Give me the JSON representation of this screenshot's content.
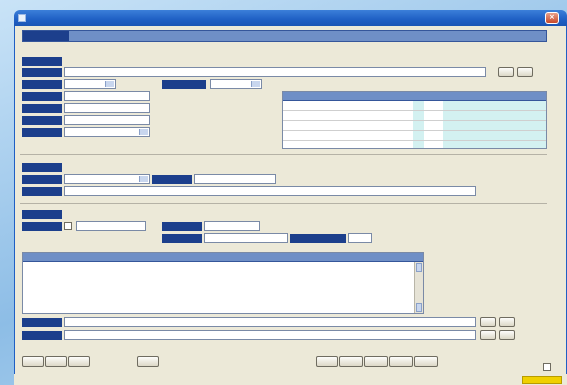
{
  "window": {
    "title": "",
    "colors": {
      "titlebar": "#1f5fc4",
      "band": "#6f8fc6",
      "grid_highlight": "#d3f1f1",
      "status_badge": "#f0d000"
    }
  },
  "icons": {
    "app": "app-icon",
    "close": "close-icon"
  }
}
